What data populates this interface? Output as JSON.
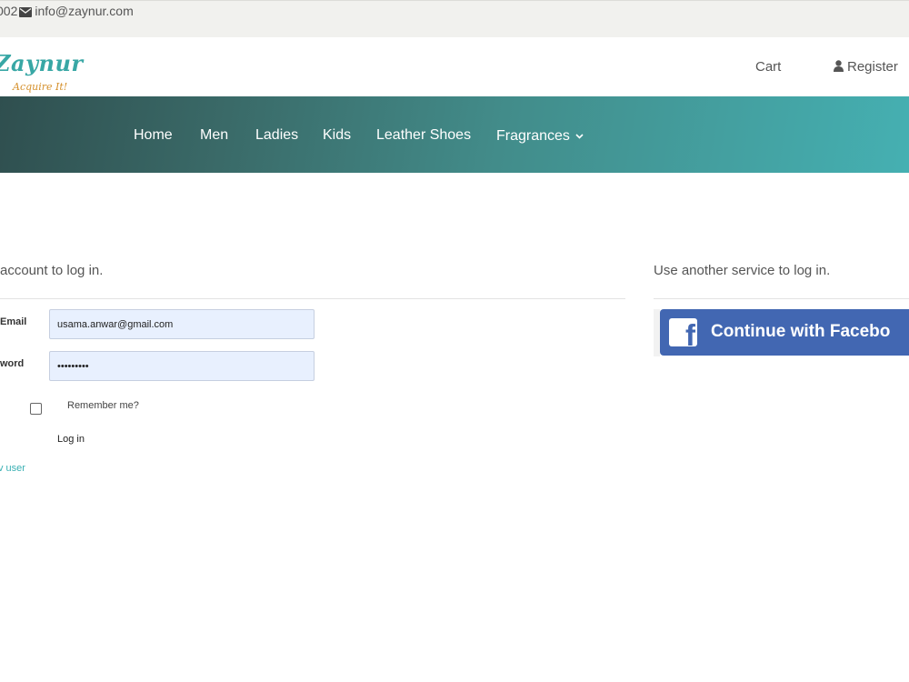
{
  "topbar": {
    "phone_fragment": "002",
    "email": "info@zaynur.com"
  },
  "logo": {
    "name": "Zaynur",
    "tagline": "Acquire It!"
  },
  "header": {
    "cart_label": "Cart",
    "register_label": "Register"
  },
  "nav": {
    "items": [
      {
        "label": "Home"
      },
      {
        "label": "Men"
      },
      {
        "label": "Ladies"
      },
      {
        "label": "Kids"
      },
      {
        "label": "Leather Shoes"
      },
      {
        "label": "Fragrances"
      }
    ]
  },
  "login": {
    "title": "account to log in.",
    "email_label": "Email",
    "email_value": "usama.anwar@gmail.com",
    "password_label": "word",
    "password_value": "•••••••••",
    "remember_label": "Remember me?",
    "login_button": "Log in",
    "register_link": "v user"
  },
  "external": {
    "title": "Use another service to log in.",
    "facebook_button": "Continue with Facebo"
  },
  "colors": {
    "brand_teal": "#38a7a5",
    "facebook_blue": "#4267b2",
    "link": "#3ab0b3"
  }
}
